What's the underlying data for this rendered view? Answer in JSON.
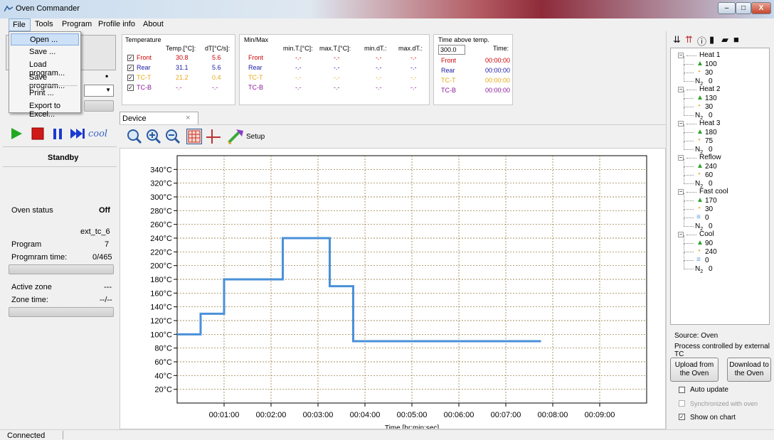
{
  "window": {
    "title": "Oven Commander",
    "minimize": "–",
    "maximize": "□",
    "close": "X"
  },
  "menu": {
    "items": [
      "File",
      "Tools",
      "Program",
      "Profile info",
      "About"
    ]
  },
  "file_menu": {
    "items": [
      "Open ...",
      "Save ...",
      "Load program...",
      "Save program...",
      "Print ...",
      "Export to Excel..."
    ]
  },
  "left": {
    "status_text": "Standby",
    "oven_status_label": "Oven status",
    "oven_status_value": "Off",
    "profile_name": "ext_tc_6",
    "program_label": "Program",
    "program_value": "7",
    "program_time_label": "Progmram time:",
    "program_time_value": "0/465",
    "active_zone_label": "Active zone",
    "active_zone_value": "---",
    "zone_time_label": "Zone time:",
    "zone_time_value": "--/--",
    "dot": "•",
    "combo_arrow": "▼"
  },
  "temperature": {
    "title": "Temperature",
    "col1": "Temp.[°C]:",
    "col2": "dT[°C/s]:",
    "rows": [
      {
        "name": "Front",
        "temp": "30.8",
        "dt": "5.6",
        "color": "#cc0000"
      },
      {
        "name": "Rear",
        "temp": "31.1",
        "dt": "5.6",
        "color": "#1a1aa6"
      },
      {
        "name": "TC-T",
        "temp": "21.2",
        "dt": "0.4",
        "color": "#e6a817"
      },
      {
        "name": "TC-B",
        "temp": "-.-",
        "dt": "-.-",
        "color": "#8a1a9a"
      }
    ],
    "check": "✓"
  },
  "minmax": {
    "title": "Min/Max",
    "cols": [
      "min.T.[°C]:",
      "max.T.[°C]:",
      "min.dT.:",
      "max.dT.:"
    ],
    "rows": [
      {
        "name": "Front",
        "vals": [
          "-.-",
          "-.-",
          "-.-",
          "-.-"
        ]
      },
      {
        "name": "Rear",
        "vals": [
          "-.-",
          "-.-",
          "-.-",
          "-.-"
        ]
      },
      {
        "name": "TC-T",
        "vals": [
          "-.-",
          "-.-",
          "-.-",
          "-.-"
        ]
      },
      {
        "name": "TC-B",
        "vals": [
          "-.-",
          "-.-",
          "-.-",
          "-.-"
        ]
      }
    ]
  },
  "time_above": {
    "title": "Time above temp.",
    "value": "300.0",
    "time_label": "Time:",
    "rows": [
      {
        "name": "Front",
        "time": "00:00:00"
      },
      {
        "name": "Rear",
        "time": "00:00:00"
      },
      {
        "name": "TC-T",
        "time": "00:00:00"
      },
      {
        "name": "TC-B",
        "time": "00:00:00"
      }
    ]
  },
  "tabs": {
    "device": "Device",
    "close": "×"
  },
  "toolbar": {
    "setup": "Setup",
    "cool": "cool"
  },
  "chart_data": {
    "type": "line",
    "xlabel": "Time [hr:min:sec]",
    "ylabel": "",
    "ylim": [
      0,
      360
    ],
    "xlim": [
      0,
      600
    ],
    "yticks": [
      "20°C",
      "40°C",
      "60°C",
      "80°C",
      "100°C",
      "120°C",
      "140°C",
      "160°C",
      "180°C",
      "200°C",
      "220°C",
      "240°C",
      "260°C",
      "280°C",
      "300°C",
      "320°C",
      "340°C"
    ],
    "xticks": [
      "00:01:00",
      "00:02:00",
      "00:03:00",
      "00:04:00",
      "00:05:00",
      "00:06:00",
      "00:07:00",
      "00:08:00",
      "00:09:00"
    ],
    "grid": true,
    "series": [
      {
        "color": "#4a90d9",
        "x": [
          0,
          30,
          30,
          60,
          60,
          135,
          135,
          195,
          195,
          225,
          225,
          465
        ],
        "y": [
          100,
          100,
          130,
          130,
          180,
          180,
          240,
          240,
          170,
          170,
          90,
          90
        ]
      }
    ]
  },
  "tree": {
    "toolbar_icons": [
      "sort-down-icon",
      "sort-up-icon",
      "info-icon",
      "new-file-icon",
      "open-folder-icon",
      "save-icon"
    ],
    "nodes": [
      {
        "name": "Heat 1",
        "temp": "100",
        "time": "30",
        "n2": "0"
      },
      {
        "name": "Heat 2",
        "temp": "130",
        "time": "30",
        "n2": "0"
      },
      {
        "name": "Heat 3",
        "temp": "180",
        "time": "75",
        "n2": "0"
      },
      {
        "name": "Reflow",
        "temp": "240",
        "time": "60",
        "n2": "0"
      },
      {
        "name": "Fast cool",
        "temp": "170",
        "time": "30",
        "fan": "0",
        "n2": "0"
      },
      {
        "name": "Cool",
        "temp": "90",
        "time": "240",
        "fan": "0",
        "n2": "0"
      }
    ],
    "n2_prefix": "N",
    "n2_sub": "2"
  },
  "right": {
    "source": "Source: Oven",
    "process": "Process controlled by external TC",
    "upload": "Upload from the Oven",
    "download": "Download to the Oven",
    "auto_update": "Auto update",
    "synchronized": "Synchronized with oven",
    "show_on_chart": "Show on chart",
    "check": "✓"
  },
  "status": {
    "connection": "Connected"
  }
}
